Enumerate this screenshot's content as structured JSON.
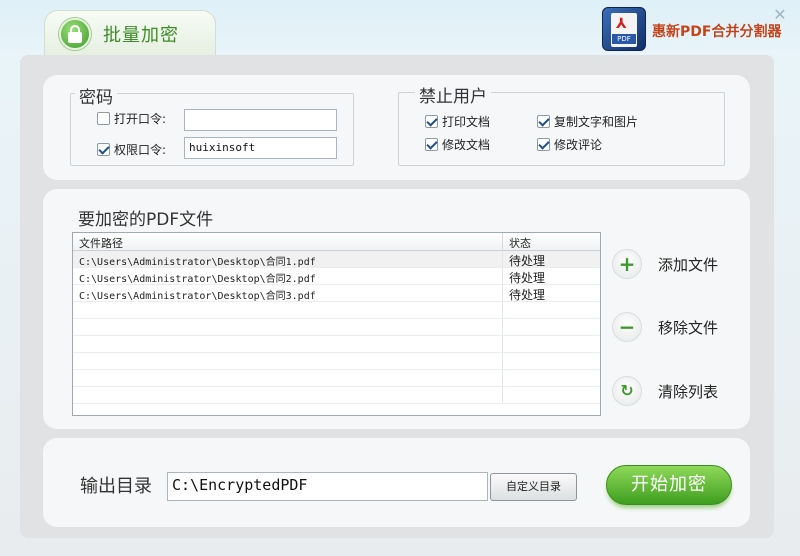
{
  "header": {
    "title": "批量加密",
    "brand": "惠新PDF合并分割器",
    "close": "✕"
  },
  "password": {
    "legend": "密码",
    "open_label": "打开口令:",
    "open_checked": false,
    "open_value": "",
    "perm_label": "权限口令:",
    "perm_checked": true,
    "perm_value": "huixinsoft"
  },
  "deny": {
    "legend": "禁止用户",
    "items": [
      {
        "label": "打印文档",
        "checked": true
      },
      {
        "label": "复制文字和图片",
        "checked": true
      },
      {
        "label": "修改文档",
        "checked": true
      },
      {
        "label": "修改评论",
        "checked": true
      }
    ]
  },
  "files": {
    "title": "要加密的PDF文件",
    "columns": [
      "文件路径",
      "状态"
    ],
    "rows": [
      {
        "path": "C:\\Users\\Administrator\\Desktop\\合同1.pdf",
        "status": "待处理"
      },
      {
        "path": "C:\\Users\\Administrator\\Desktop\\合同2.pdf",
        "status": "待处理"
      },
      {
        "path": "C:\\Users\\Administrator\\Desktop\\合同3.pdf",
        "status": "待处理"
      }
    ]
  },
  "actions": {
    "add": "添加文件",
    "remove": "移除文件",
    "clear": "清除列表"
  },
  "output": {
    "label": "输出目录",
    "value": "C:\\EncryptedPDF",
    "custom_btn": "自定义目录",
    "start_btn": "开始加密"
  }
}
